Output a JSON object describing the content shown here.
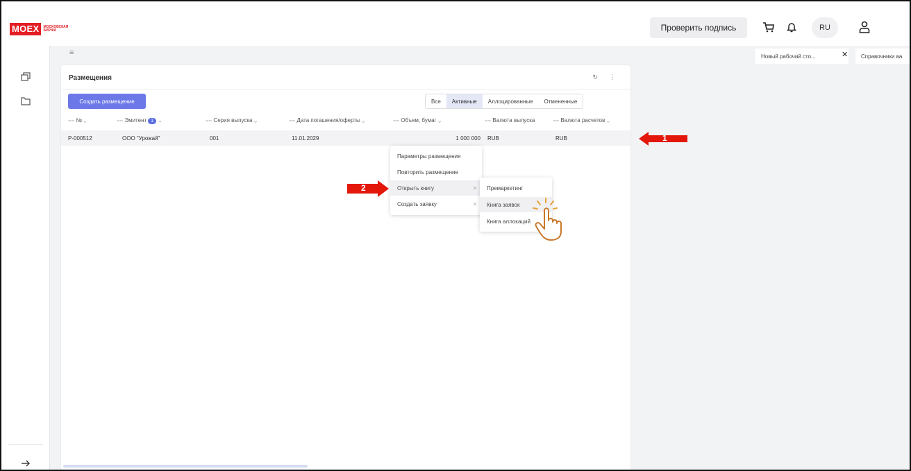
{
  "header": {
    "logo_main": "MOEX",
    "logo_sub_line1": "МОСКОВСКАЯ",
    "logo_sub_line2": "БИРЖА",
    "verify_signature": "Проверить подпись",
    "lang": "RU",
    "icons": [
      "cart-icon",
      "bell-icon",
      "user-icon"
    ]
  },
  "tabs": [
    {
      "label": "Новый рабочий сто..."
    },
    {
      "label": "Справочники ва"
    }
  ],
  "rail": {
    "icons": [
      "layers-icon",
      "folder-icon",
      "arrow-right-icon"
    ]
  },
  "panel": {
    "title": "Размещения",
    "create_button": "Создать размещение",
    "filters": [
      "Все",
      "Активные",
      "Аллоцированные",
      "Отмененные"
    ],
    "active_filter": "Активные",
    "columns": [
      "№",
      "Эмитент",
      "Серия выпуска",
      "Дата погашения/оферты",
      "Объем, бумаг",
      "Валюта выпуска",
      "Валюта расчетов"
    ],
    "issuer_filter_count": "1",
    "rows": [
      {
        "number": "P-000512",
        "issuer": "ООО \"Урожай\"",
        "series": "001",
        "maturity_date": "11.01.2029",
        "volume": "1 000 000",
        "issue_currency": "RUB",
        "settlement_currency": "RUB"
      }
    ]
  },
  "context_menu": {
    "items": [
      "Параметры размещения",
      "Повторить размещение",
      "Открыть книгу",
      "Создать заявку"
    ],
    "chevron": ">"
  },
  "submenu": {
    "items": [
      "Премаркетинг",
      "Книга заявок",
      "Книга аллокаций"
    ]
  },
  "annotations": {
    "arrow1": "1",
    "arrow2": "2",
    "accent_color": "#e3170a"
  }
}
